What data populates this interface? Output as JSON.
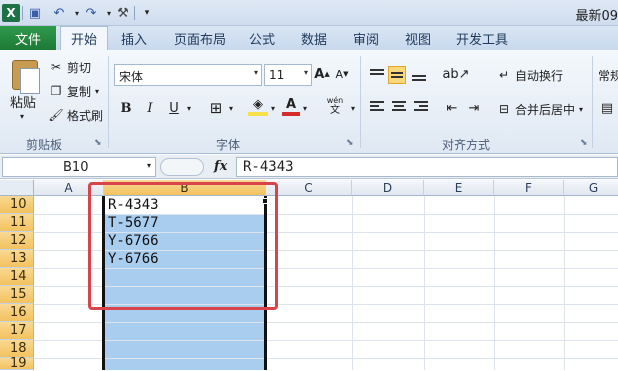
{
  "title": "最新09",
  "quick_access": {
    "logo": "X",
    "save": "💾",
    "undo": "↶",
    "redo": "↷",
    "tools": "⚒",
    "more": "▾"
  },
  "tabs": [
    "文件",
    "开始",
    "插入",
    "页面布局",
    "公式",
    "数据",
    "审阅",
    "视图",
    "开发工具"
  ],
  "clipboard": {
    "paste": "粘贴",
    "cut": "剪切",
    "copy": "复制",
    "format_painter": "格式刷",
    "group": "剪贴板"
  },
  "font": {
    "name": "宋体",
    "size": "11",
    "grow": "A",
    "shrink": "A",
    "bold": "B",
    "italic": "I",
    "underline": "U",
    "group": "字体",
    "wen": "wén"
  },
  "alignment": {
    "wrap": "自动换行",
    "merge": "合并后居中",
    "group": "对齐方式"
  },
  "number": {
    "format": "常规"
  },
  "formula_bar": {
    "name_box": "B10",
    "fx": "fx",
    "formula": "R-4343"
  },
  "columns": [
    "A",
    "B",
    "C",
    "D",
    "E",
    "F",
    "G"
  ],
  "rows": [
    "10",
    "11",
    "12",
    "13",
    "14",
    "15",
    "16",
    "17",
    "18",
    "19"
  ],
  "cells": [
    "R-4343",
    "T-5677",
    "Y-6766",
    "Y-6766"
  ]
}
